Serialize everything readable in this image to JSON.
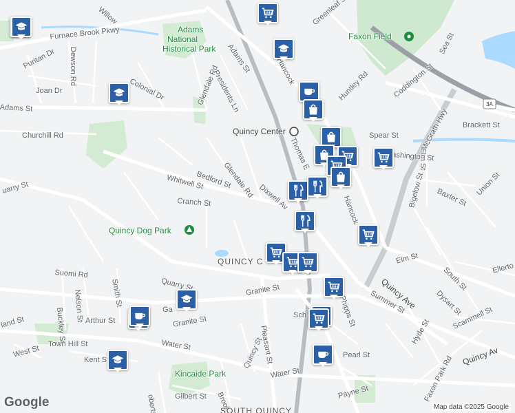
{
  "map": {
    "labels": {
      "adams_st_w": "Adams St",
      "adams_st_n": "Adams St",
      "furnace_brook": "Furnace Brook Pkwy",
      "willow": "Willow",
      "puritan": "Puritan Dr",
      "joan": "Joan Dr",
      "dewson": "Dewson Rd",
      "colonial": "Colonial Dr",
      "churchill": "Churchill Rd",
      "glendale_n": "Glendale Rd",
      "presidents": "Presidents Ln",
      "greenleaf": "Greenleaf St",
      "hancock_n": "Hancock",
      "huntley": "Huntley Rd",
      "coddington": "Coddington St",
      "mcgrath": "McGrath Hwy",
      "sea": "Sea St",
      "brackett": "Brackett St",
      "spear": "Spear St",
      "washington": "Washington St",
      "elm_e": "Elm St",
      "thomas": "Thomas E",
      "bedford": "Bedford St",
      "glendale_s": "Glendale Rd",
      "whitwell": "Whitwell St",
      "cranch": "Cranch St",
      "dixwell": "Dixwell Av",
      "hancock_s": "Hancock",
      "bigelow": "Bigelow St",
      "baxter": "Baxter St",
      "union": "Union St",
      "quarry_w": "uarry St",
      "quarry": "Quarry St",
      "suomi": "Suomi Rd",
      "smith": "Smith St",
      "nelson": "Nelson St",
      "buckley": "Buckley St",
      "arthur": "Arthur St",
      "granite_w": "Granite St",
      "granite": "Granite St",
      "garfield": "Ga",
      "town_hill": "Town Hill St",
      "west": "West St",
      "kent": "Kent St",
      "water_w": "Water St",
      "water": "Water St",
      "highland": "land St",
      "quincy_st": "Quincy St",
      "pleasant": "Pleasant St",
      "brook": "Brook Rd",
      "gilbert": "Gilbert St",
      "roberts": "oberts",
      "elm_s": "Elm St",
      "south": "South St",
      "ellerton": "Ellerto",
      "dysart": "Dysart St",
      "summer": "Summer St",
      "quincy_ave": "Quincy Ave",
      "scammell": "Scammell St",
      "hyde": "Hyde St",
      "quincy_av_e": "Quincy Av",
      "faxon_park": "Faxon Park Rd",
      "phipps": "Phipps St",
      "pearl": "Pearl St",
      "payne": "Payne St",
      "school": "Sch",
      "quincy_center": "Quincy Center",
      "adams_park": [
        "Adams",
        "National",
        "Historical Park"
      ],
      "faxon_field": "Faxon Field",
      "quincy_dog_park": "Quincy Dog Park",
      "kincaide_park": "Kincaide Park",
      "quincy_c": "QUINCY C",
      "south_quincy": "SOUTH QUINCY",
      "route_3a": "3A"
    },
    "markers": [
      {
        "type": "school-icon"
      },
      {
        "type": "grocery-icon"
      },
      {
        "type": "school-icon"
      },
      {
        "type": "school-icon"
      },
      {
        "type": "school-icon"
      },
      {
        "type": "coffee-icon"
      },
      {
        "type": "shopping-bag-icon"
      },
      {
        "type": "shopping-bag-icon"
      },
      {
        "type": "shopping-bag-icon"
      },
      {
        "type": "grocery-icon"
      },
      {
        "type": "grocery-icon"
      },
      {
        "type": "grocery-icon"
      },
      {
        "type": "shopping-bag-icon"
      },
      {
        "type": "restaurant-icon"
      },
      {
        "type": "restaurant-icon"
      },
      {
        "type": "restaurant-icon"
      },
      {
        "type": "grocery-icon"
      },
      {
        "type": "grocery-icon"
      },
      {
        "type": "grocery-icon"
      },
      {
        "type": "grocery-icon"
      },
      {
        "type": "grocery-icon"
      },
      {
        "type": "grocery-icon"
      },
      {
        "type": "coffee-icon"
      },
      {
        "type": "grocery-icon"
      },
      {
        "type": "school-icon"
      },
      {
        "type": "coffee-icon"
      },
      {
        "type": "school-icon"
      },
      {
        "type": "coffee-icon"
      }
    ],
    "colors": {
      "marker": "#2b5fa6",
      "park": "#c8e6c9",
      "water": "#9fd4ef",
      "highway": "#9aa0a6",
      "background": "#f1f3f4"
    }
  },
  "footer": {
    "logo": "Google",
    "attribution": "Map data ©2025 Google"
  }
}
